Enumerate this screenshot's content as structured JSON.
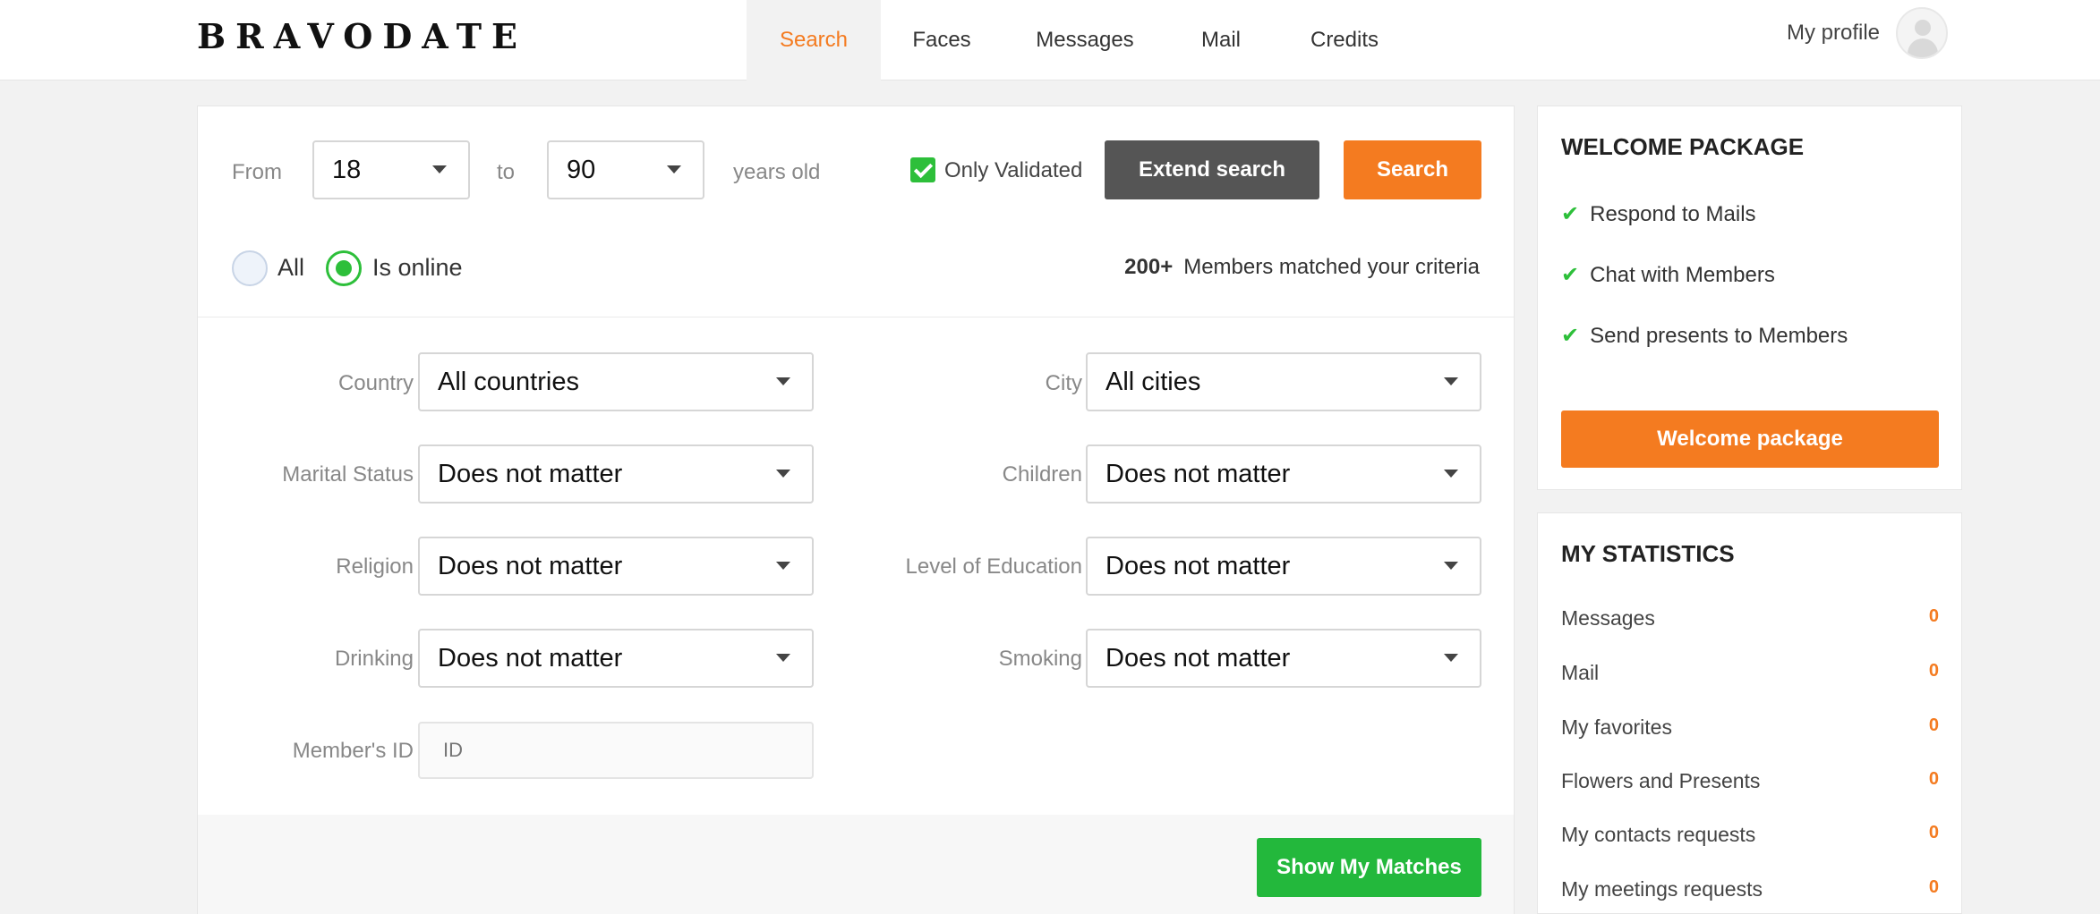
{
  "header": {
    "logo": "BRAVODATE",
    "nav": [
      "Search",
      "Faces",
      "Messages",
      "Mail",
      "Credits"
    ],
    "active_nav": "Search",
    "profile_label": "My profile"
  },
  "search": {
    "from_label": "From",
    "age_from": "18",
    "to_label": "to",
    "age_to": "90",
    "years_label": "years old",
    "only_validated_label": "Only Validated",
    "only_validated_checked": true,
    "extend_label": "Extend search",
    "search_label": "Search",
    "radio_all": "All",
    "radio_online": "Is online",
    "radio_selected": "Is online",
    "match_count": "200+",
    "match_text": "Members matched your criteria"
  },
  "filters": {
    "country_label": "Country",
    "country_value": "All countries",
    "city_label": "City",
    "city_value": "All cities",
    "marital_label": "Marital Status",
    "marital_value": "Does not matter",
    "children_label": "Children",
    "children_value": "Does not matter",
    "religion_label": "Religion",
    "religion_value": "Does not matter",
    "education_label": "Level of Education",
    "education_value": "Does not matter",
    "drinking_label": "Drinking",
    "drinking_value": "Does not matter",
    "smoking_label": "Smoking",
    "smoking_value": "Does not matter",
    "member_id_label": "Member's ID",
    "member_id_placeholder": "ID",
    "show_matches_label": "Show My Matches"
  },
  "welcome": {
    "title": "WELCOME PACKAGE",
    "items": [
      "Respond to Mails",
      "Chat with Members",
      "Send presents to Members"
    ],
    "button_label": "Welcome package"
  },
  "stats": {
    "title": "MY STATISTICS",
    "rows": [
      {
        "label": "Messages",
        "value": "0"
      },
      {
        "label": "Mail",
        "value": "0"
      },
      {
        "label": "My favorites",
        "value": "0"
      },
      {
        "label": "Flowers and Presents",
        "value": "0"
      },
      {
        "label": "My contacts requests",
        "value": "0"
      },
      {
        "label": "My meetings requests",
        "value": "0"
      }
    ]
  },
  "colors": {
    "accent": "#f47b20",
    "success": "#23b83c",
    "dark_button": "#555555"
  }
}
